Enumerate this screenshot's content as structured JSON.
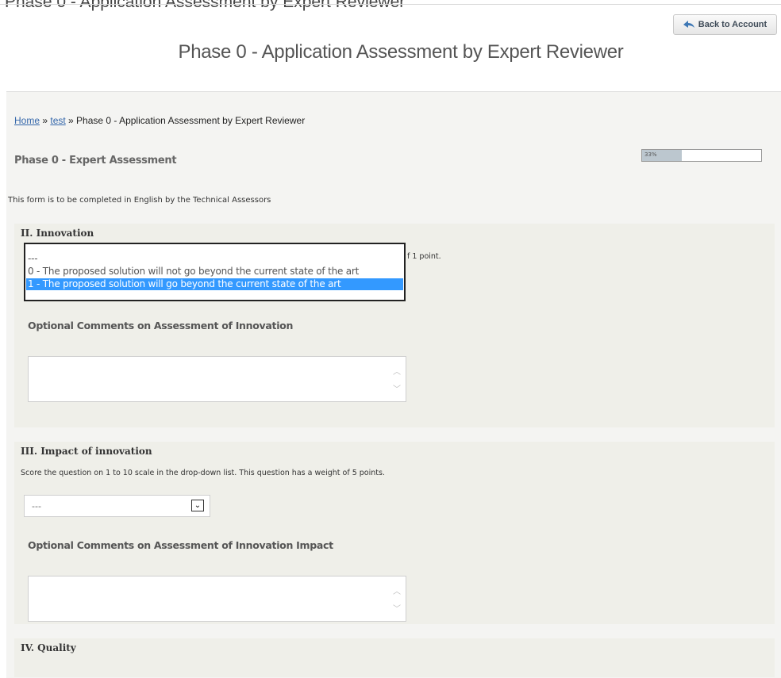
{
  "header": {
    "cut_text": "Phase 0 - Application Assessment by Expert Reviewer",
    "back_button": "Back to Account",
    "page_title": "Phase 0 - Application Assessment by Expert Reviewer"
  },
  "breadcrumb": {
    "home": "Home",
    "sep1": " » ",
    "test": "test",
    "sep2": " » ",
    "current": "Phase 0 - Application Assessment by Expert Reviewer"
  },
  "form": {
    "title": "Phase 0 - Expert Assessment",
    "progress_label": "33%",
    "progress_fraction": 0.33,
    "intro": "This form is to be completed in English by the Technical Assessors"
  },
  "innovation": {
    "heading": "II. Innovation",
    "desc_tail": "f 1 point.",
    "options": [
      "---",
      "0 - The proposed solution will not go beyond the current state of the art",
      "1 - The proposed solution will go beyond the current state of the art"
    ],
    "highlighted_index": 2,
    "comments_label": "Optional Comments on Assessment of Innovation"
  },
  "impact": {
    "heading": "III. Impact of innovation",
    "desc": "Score the question on 1 to 10 scale in the drop-down list. This question has a weight of 5 points.",
    "select_value": "---",
    "comments_label": "Optional Comments on Assessment of Innovation Impact"
  },
  "quality": {
    "heading": "IV. Quality"
  },
  "colors": {
    "link": "#3366aa",
    "highlight": "#3399ff",
    "section_bg": "#efefe9",
    "content_bg": "#f4f4f2"
  }
}
